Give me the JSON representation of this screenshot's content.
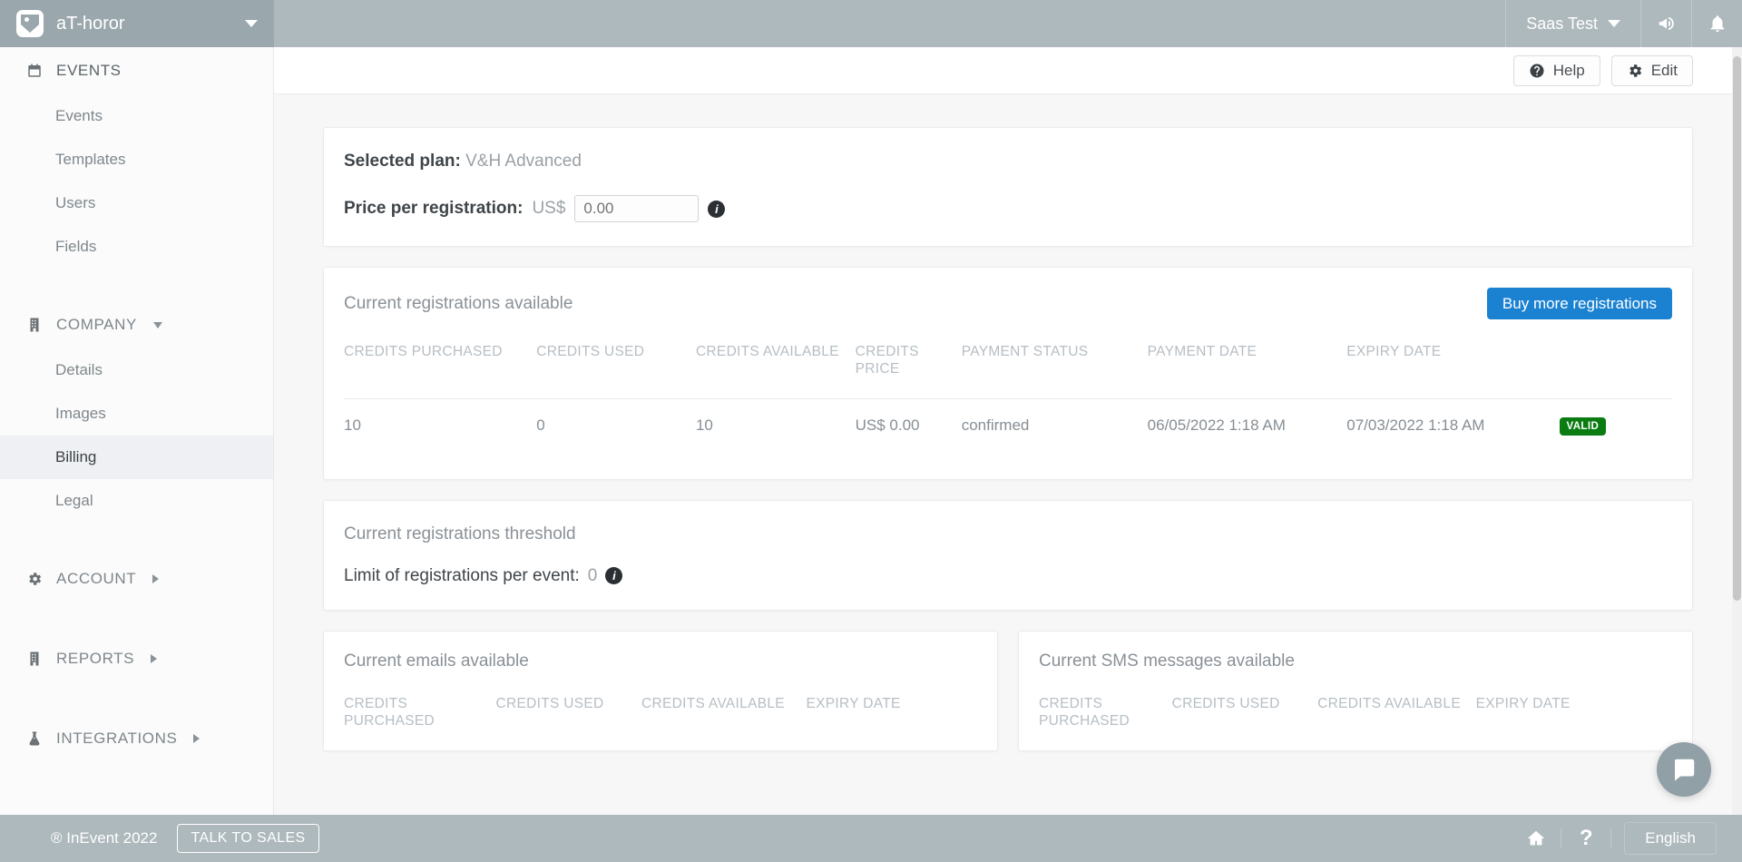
{
  "topbar": {
    "workspace_name": "aT-horor",
    "workspace_chevron": "chevron-down-icon",
    "user_name": "Saas Test",
    "megaphone_icon": "megaphone-icon",
    "bell_icon": "bell-icon"
  },
  "sidebar": {
    "groups": [
      {
        "label": "EVENTS",
        "icon": "calendar-icon",
        "expanded": true,
        "items": [
          {
            "label": "Events",
            "active": false
          },
          {
            "label": "Templates",
            "active": false
          },
          {
            "label": "Users",
            "active": false
          },
          {
            "label": "Fields",
            "active": false
          }
        ]
      },
      {
        "label": "COMPANY",
        "icon": "building-icon",
        "expanded": true,
        "items": [
          {
            "label": "Details",
            "active": false
          },
          {
            "label": "Images",
            "active": false
          },
          {
            "label": "Billing",
            "active": true
          },
          {
            "label": "Legal",
            "active": false
          }
        ]
      },
      {
        "label": "ACCOUNT",
        "icon": "gear-icon",
        "expanded": false,
        "items": []
      },
      {
        "label": "REPORTS",
        "icon": "building-icon",
        "expanded": false,
        "items": []
      },
      {
        "label": "INTEGRATIONS",
        "icon": "flask-icon",
        "expanded": false,
        "items": []
      }
    ]
  },
  "action_bar": {
    "help_label": "Help",
    "help_icon": "question-circle-icon",
    "edit_label": "Edit",
    "edit_icon": "gear-icon"
  },
  "plan_card": {
    "selected_plan_label": "Selected plan:",
    "selected_plan_value": "V&H Advanced",
    "price_label": "Price per registration:",
    "currency": "US$",
    "price_placeholder": "0.00",
    "price_value": "",
    "info_icon": "info-icon"
  },
  "registrations_card": {
    "title": "Current registrations available",
    "buy_button": "Buy more registrations",
    "columns": [
      "CREDITS PURCHASED",
      "CREDITS USED",
      "CREDITS AVAILABLE",
      "CREDITS PRICE",
      "PAYMENT STATUS",
      "PAYMENT DATE",
      "EXPIRY DATE",
      ""
    ],
    "rows": [
      {
        "credits_purchased": "10",
        "credits_used": "0",
        "credits_available": "10",
        "credits_price": "US$ 0.00",
        "payment_status": "confirmed",
        "payment_date": "06/05/2022 1:18 AM",
        "expiry_date": "07/03/2022 1:18 AM",
        "status_badge": "VALID"
      }
    ]
  },
  "threshold_card": {
    "title": "Current registrations threshold",
    "limit_label": "Limit of registrations per event:",
    "limit_value": "0",
    "info_icon": "info-icon"
  },
  "emails_card": {
    "title": "Current emails available",
    "columns": [
      "CREDITS PURCHASED",
      "CREDITS USED",
      "CREDITS AVAILABLE",
      "EXPIRY DATE"
    ]
  },
  "sms_card": {
    "title": "Current SMS messages available",
    "columns": [
      "CREDITS PURCHASED",
      "CREDITS USED",
      "CREDITS AVAILABLE",
      "EXPIRY DATE"
    ]
  },
  "chat": {
    "icon": "chat-bubble-icon"
  },
  "footer": {
    "copyright": "® InEvent 2022",
    "talk_to_sales": "TALK TO SALES",
    "home_icon": "home-icon",
    "help_icon": "question-mark-icon",
    "language": "English"
  },
  "colors": {
    "bar": "#aeb9bd",
    "brand_bar": "#9aa7ac",
    "primary_button": "#1b82d2",
    "valid_badge": "#0a7c12",
    "active_nav": "#eef0f3"
  }
}
